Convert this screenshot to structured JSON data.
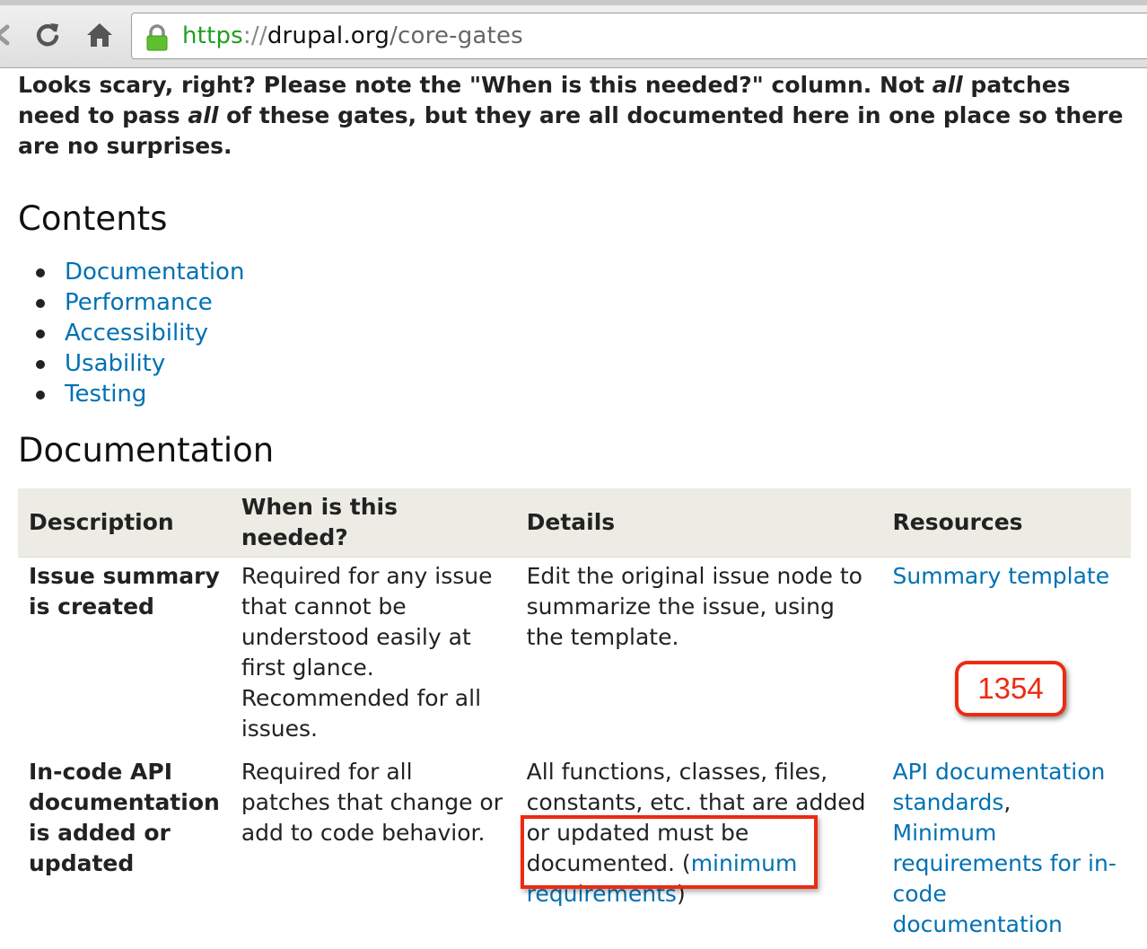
{
  "browser": {
    "url_protocol": "https",
    "url_separator": "://",
    "url_host": "drupal.org",
    "url_path": "/core-gates"
  },
  "intro": {
    "part1": "Looks scary, right? Please note the \"When is this needed?\" column. Not ",
    "em1": "all",
    "part2": " patches need to pass ",
    "em2": "all",
    "part3": " of these gates, but they are all documented here in one place so there are no surprises."
  },
  "contents": {
    "heading": "Contents",
    "items": [
      {
        "label": "Documentation"
      },
      {
        "label": "Performance"
      },
      {
        "label": "Accessibility"
      },
      {
        "label": "Usability"
      },
      {
        "label": "Testing"
      }
    ]
  },
  "documentation": {
    "heading": "Documentation",
    "columns": [
      "Description",
      "When is this needed?",
      "Details",
      "Resources"
    ],
    "rows": [
      {
        "description": "Issue summary is created",
        "when_line1": "Required for any issue that cannot be understood easily at first glance.",
        "when_line2": "Recommended for all issues.",
        "details": "Edit the original issue node to summarize the issue, using the template.",
        "resource_link": "Summary template"
      },
      {
        "description": "In-code API documentation is added or updated",
        "when": "Required for all patches that change or add to code behavior.",
        "details_text": "All functions, classes, files, constants, etc. that are added or updated must be documented. (",
        "details_link": "minimum requirements",
        "details_close": ")",
        "resource_link1": "API documentation standards",
        "resource_sep": ",",
        "resource_link2": "Minimum requirements for in-code documentation"
      }
    ]
  },
  "annotation": {
    "callout_label": "1354",
    "accent_color": "#ec2b12"
  },
  "colors": {
    "link": "#0071b3",
    "table_header_bg": "#ecece4",
    "secure_green": "#1f9f1f"
  }
}
